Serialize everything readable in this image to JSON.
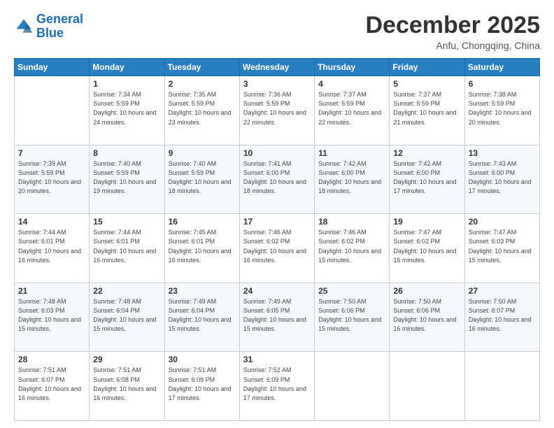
{
  "logo": {
    "line1": "General",
    "line2": "Blue"
  },
  "title": "December 2025",
  "subtitle": "Anfu, Chongqing, China",
  "days": [
    "Sunday",
    "Monday",
    "Tuesday",
    "Wednesday",
    "Thursday",
    "Friday",
    "Saturday"
  ],
  "weeks": [
    [
      {
        "day": "",
        "sunrise": "",
        "sunset": "",
        "daylight": ""
      },
      {
        "day": "1",
        "sunrise": "Sunrise: 7:34 AM",
        "sunset": "Sunset: 5:59 PM",
        "daylight": "Daylight: 10 hours and 24 minutes."
      },
      {
        "day": "2",
        "sunrise": "Sunrise: 7:35 AM",
        "sunset": "Sunset: 5:59 PM",
        "daylight": "Daylight: 10 hours and 23 minutes."
      },
      {
        "day": "3",
        "sunrise": "Sunrise: 7:36 AM",
        "sunset": "Sunset: 5:59 PM",
        "daylight": "Daylight: 10 hours and 22 minutes."
      },
      {
        "day": "4",
        "sunrise": "Sunrise: 7:37 AM",
        "sunset": "Sunset: 5:59 PM",
        "daylight": "Daylight: 10 hours and 22 minutes."
      },
      {
        "day": "5",
        "sunrise": "Sunrise: 7:37 AM",
        "sunset": "Sunset: 5:59 PM",
        "daylight": "Daylight: 10 hours and 21 minutes."
      },
      {
        "day": "6",
        "sunrise": "Sunrise: 7:38 AM",
        "sunset": "Sunset: 5:59 PM",
        "daylight": "Daylight: 10 hours and 20 minutes."
      }
    ],
    [
      {
        "day": "7",
        "sunrise": "Sunrise: 7:39 AM",
        "sunset": "Sunset: 5:59 PM",
        "daylight": "Daylight: 10 hours and 20 minutes."
      },
      {
        "day": "8",
        "sunrise": "Sunrise: 7:40 AM",
        "sunset": "Sunset: 5:59 PM",
        "daylight": "Daylight: 10 hours and 19 minutes."
      },
      {
        "day": "9",
        "sunrise": "Sunrise: 7:40 AM",
        "sunset": "Sunset: 5:59 PM",
        "daylight": "Daylight: 10 hours and 18 minutes."
      },
      {
        "day": "10",
        "sunrise": "Sunrise: 7:41 AM",
        "sunset": "Sunset: 6:00 PM",
        "daylight": "Daylight: 10 hours and 18 minutes."
      },
      {
        "day": "11",
        "sunrise": "Sunrise: 7:42 AM",
        "sunset": "Sunset: 6:00 PM",
        "daylight": "Daylight: 10 hours and 18 minutes."
      },
      {
        "day": "12",
        "sunrise": "Sunrise: 7:42 AM",
        "sunset": "Sunset: 6:00 PM",
        "daylight": "Daylight: 10 hours and 17 minutes."
      },
      {
        "day": "13",
        "sunrise": "Sunrise: 7:43 AM",
        "sunset": "Sunset: 6:00 PM",
        "daylight": "Daylight: 10 hours and 17 minutes."
      }
    ],
    [
      {
        "day": "14",
        "sunrise": "Sunrise: 7:44 AM",
        "sunset": "Sunset: 6:01 PM",
        "daylight": "Daylight: 10 hours and 16 minutes."
      },
      {
        "day": "15",
        "sunrise": "Sunrise: 7:44 AM",
        "sunset": "Sunset: 6:01 PM",
        "daylight": "Daylight: 10 hours and 16 minutes."
      },
      {
        "day": "16",
        "sunrise": "Sunrise: 7:45 AM",
        "sunset": "Sunset: 6:01 PM",
        "daylight": "Daylight: 10 hours and 16 minutes."
      },
      {
        "day": "17",
        "sunrise": "Sunrise: 7:46 AM",
        "sunset": "Sunset: 6:02 PM",
        "daylight": "Daylight: 10 hours and 16 minutes."
      },
      {
        "day": "18",
        "sunrise": "Sunrise: 7:46 AM",
        "sunset": "Sunset: 6:02 PM",
        "daylight": "Daylight: 10 hours and 15 minutes."
      },
      {
        "day": "19",
        "sunrise": "Sunrise: 7:47 AM",
        "sunset": "Sunset: 6:02 PM",
        "daylight": "Daylight: 10 hours and 15 minutes."
      },
      {
        "day": "20",
        "sunrise": "Sunrise: 7:47 AM",
        "sunset": "Sunset: 6:03 PM",
        "daylight": "Daylight: 10 hours and 15 minutes."
      }
    ],
    [
      {
        "day": "21",
        "sunrise": "Sunrise: 7:48 AM",
        "sunset": "Sunset: 6:03 PM",
        "daylight": "Daylight: 10 hours and 15 minutes."
      },
      {
        "day": "22",
        "sunrise": "Sunrise: 7:48 AM",
        "sunset": "Sunset: 6:04 PM",
        "daylight": "Daylight: 10 hours and 15 minutes."
      },
      {
        "day": "23",
        "sunrise": "Sunrise: 7:49 AM",
        "sunset": "Sunset: 6:04 PM",
        "daylight": "Daylight: 10 hours and 15 minutes."
      },
      {
        "day": "24",
        "sunrise": "Sunrise: 7:49 AM",
        "sunset": "Sunset: 6:05 PM",
        "daylight": "Daylight: 10 hours and 15 minutes."
      },
      {
        "day": "25",
        "sunrise": "Sunrise: 7:50 AM",
        "sunset": "Sunset: 6:06 PM",
        "daylight": "Daylight: 10 hours and 15 minutes."
      },
      {
        "day": "26",
        "sunrise": "Sunrise: 7:50 AM",
        "sunset": "Sunset: 6:06 PM",
        "daylight": "Daylight: 10 hours and 16 minutes."
      },
      {
        "day": "27",
        "sunrise": "Sunrise: 7:50 AM",
        "sunset": "Sunset: 6:07 PM",
        "daylight": "Daylight: 10 hours and 16 minutes."
      }
    ],
    [
      {
        "day": "28",
        "sunrise": "Sunrise: 7:51 AM",
        "sunset": "Sunset: 6:07 PM",
        "daylight": "Daylight: 10 hours and 16 minutes."
      },
      {
        "day": "29",
        "sunrise": "Sunrise: 7:51 AM",
        "sunset": "Sunset: 6:08 PM",
        "daylight": "Daylight: 10 hours and 16 minutes."
      },
      {
        "day": "30",
        "sunrise": "Sunrise: 7:51 AM",
        "sunset": "Sunset: 6:09 PM",
        "daylight": "Daylight: 10 hours and 17 minutes."
      },
      {
        "day": "31",
        "sunrise": "Sunrise: 7:52 AM",
        "sunset": "Sunset: 6:09 PM",
        "daylight": "Daylight: 10 hours and 17 minutes."
      },
      {
        "day": "",
        "sunrise": "",
        "sunset": "",
        "daylight": ""
      },
      {
        "day": "",
        "sunrise": "",
        "sunset": "",
        "daylight": ""
      },
      {
        "day": "",
        "sunrise": "",
        "sunset": "",
        "daylight": ""
      }
    ]
  ]
}
